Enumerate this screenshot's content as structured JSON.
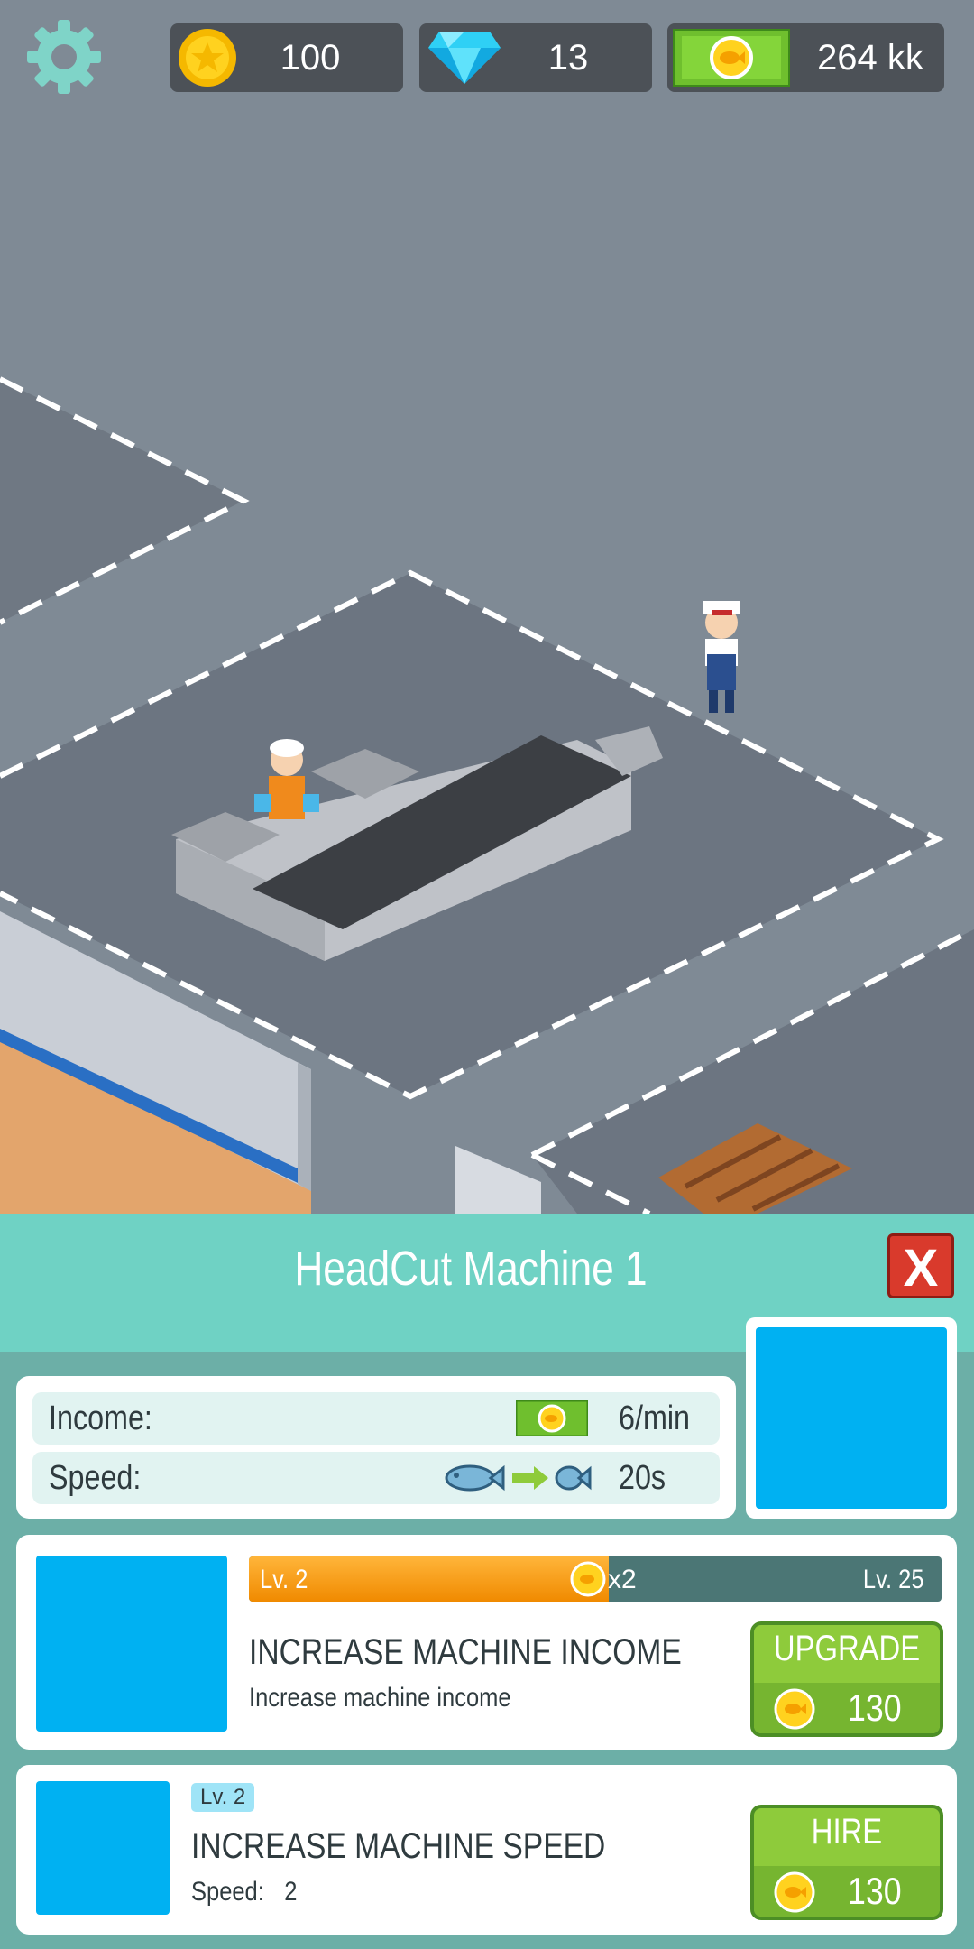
{
  "hud": {
    "coins": "100",
    "gems": "13",
    "cash": "264 kk",
    "icons": {
      "settings": "gear-icon",
      "coin": "coin-icon",
      "gem": "diamond-icon",
      "cash": "cash-bill-icon"
    }
  },
  "panel": {
    "title": "HeadCut Machine 1",
    "close_label": "X",
    "stats": {
      "income_label": "Income:",
      "income_value": "6/min",
      "speed_label": "Speed:",
      "speed_value": "20s"
    },
    "upgrade_income": {
      "level_current": "Lv. 2",
      "level_max": "Lv. 25",
      "multiplier": "x2",
      "progress": 0.52,
      "title": "INCREASE MACHINE INCOME",
      "description": "Increase machine income",
      "button_label": "UPGRADE",
      "price": "130"
    },
    "upgrade_speed": {
      "level_badge": "Lv. 2",
      "title": "INCREASE MACHINE SPEED",
      "speed_label": "Speed:",
      "speed_value": "2",
      "button_label": "HIRE",
      "price": "130"
    }
  },
  "colors": {
    "panel_header": "#6fd2c4",
    "panel_body": "#6cafa7",
    "button_green": "#8ecb3b",
    "progress_orange": "#f39a0e",
    "close_red": "#d93a2c"
  }
}
